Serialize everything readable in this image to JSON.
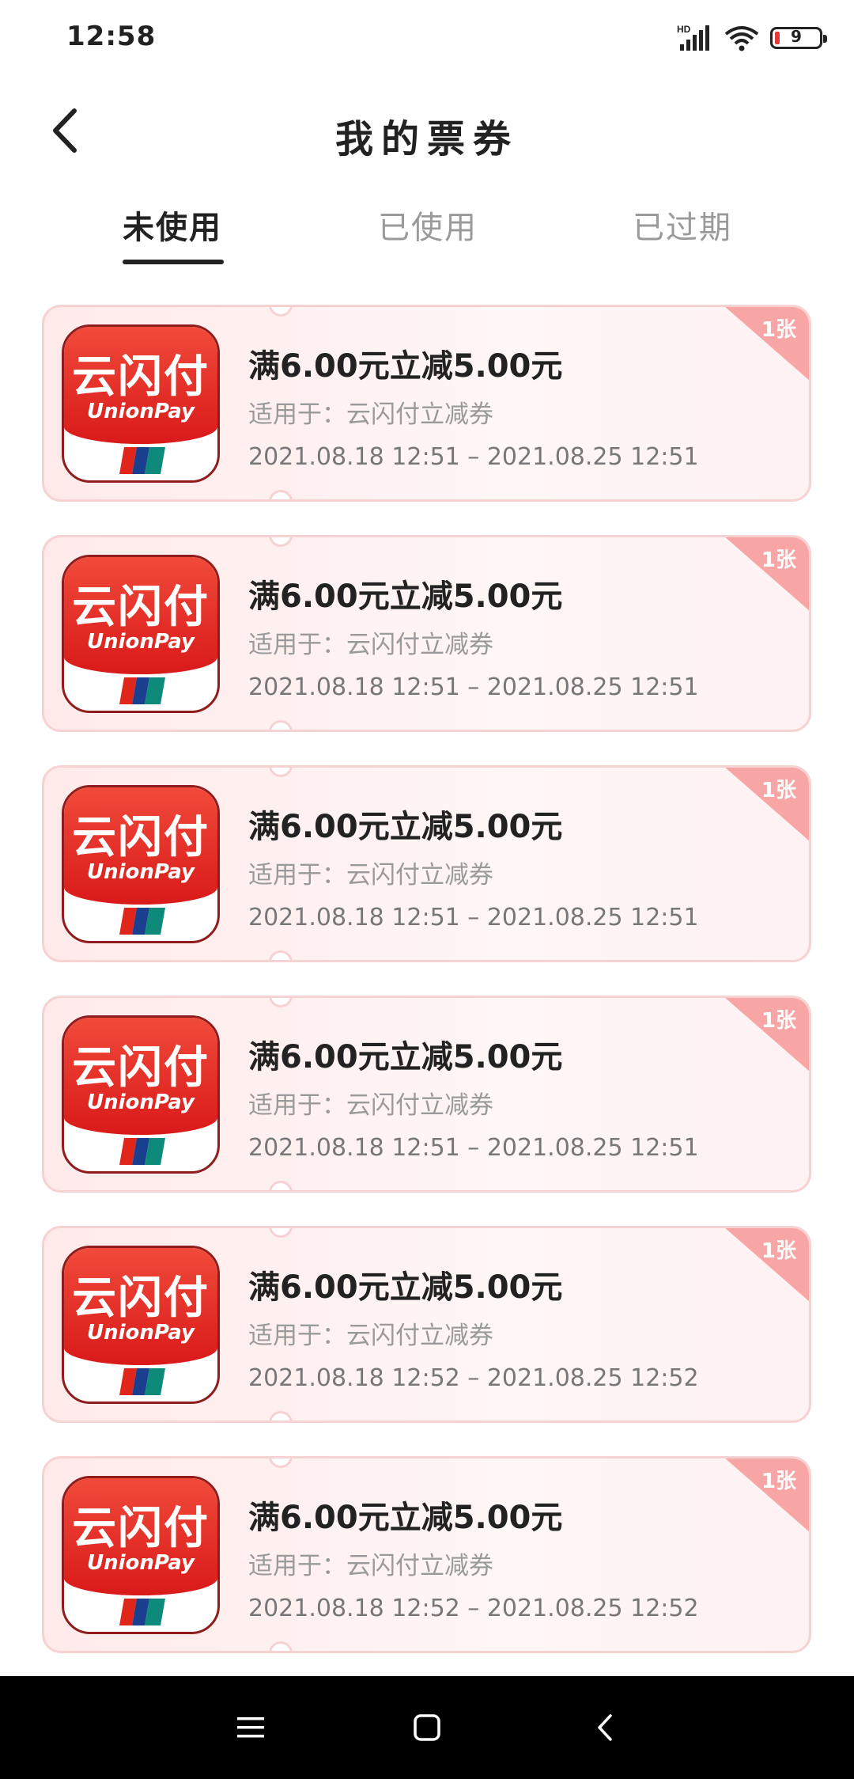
{
  "status_bar": {
    "time": "12:58",
    "network_label": "HD",
    "battery_level": "9"
  },
  "header": {
    "title": "我的票券",
    "back_icon": "chevron-left-icon"
  },
  "tabs": [
    {
      "label": "未使用",
      "active": true
    },
    {
      "label": "已使用",
      "active": false
    },
    {
      "label": "已过期",
      "active": false
    }
  ],
  "coupons": [
    {
      "title": "满6.00元立减5.00元",
      "scope": "适用于：云闪付立减券",
      "period": "2021.08.18 12:51 – 2021.08.25 12:51",
      "count": "1张",
      "logo_cn": "云闪付",
      "logo_en": "UnionPay"
    },
    {
      "title": "满6.00元立减5.00元",
      "scope": "适用于：云闪付立减券",
      "period": "2021.08.18 12:51 – 2021.08.25 12:51",
      "count": "1张",
      "logo_cn": "云闪付",
      "logo_en": "UnionPay"
    },
    {
      "title": "满6.00元立减5.00元",
      "scope": "适用于：云闪付立减券",
      "period": "2021.08.18 12:51 – 2021.08.25 12:51",
      "count": "1张",
      "logo_cn": "云闪付",
      "logo_en": "UnionPay"
    },
    {
      "title": "满6.00元立减5.00元",
      "scope": "适用于：云闪付立减券",
      "period": "2021.08.18 12:51 – 2021.08.25 12:51",
      "count": "1张",
      "logo_cn": "云闪付",
      "logo_en": "UnionPay"
    },
    {
      "title": "满6.00元立减5.00元",
      "scope": "适用于：云闪付立减券",
      "period": "2021.08.18 12:52 – 2021.08.25 12:52",
      "count": "1张",
      "logo_cn": "云闪付",
      "logo_en": "UnionPay"
    },
    {
      "title": "满6.00元立减5.00元",
      "scope": "适用于：云闪付立减券",
      "period": "2021.08.18 12:52 – 2021.08.25 12:52",
      "count": "1张",
      "logo_cn": "云闪付",
      "logo_en": "UnionPay"
    }
  ],
  "nav_bar": {
    "buttons": [
      "menu-icon",
      "home-square-icon",
      "back-triangle-icon"
    ]
  },
  "colors": {
    "accent_red": "#e0251b",
    "coupon_bg": "#ffeaea",
    "corner_tag": "#f8a5a5",
    "muted_text": "#9a9a9a"
  }
}
